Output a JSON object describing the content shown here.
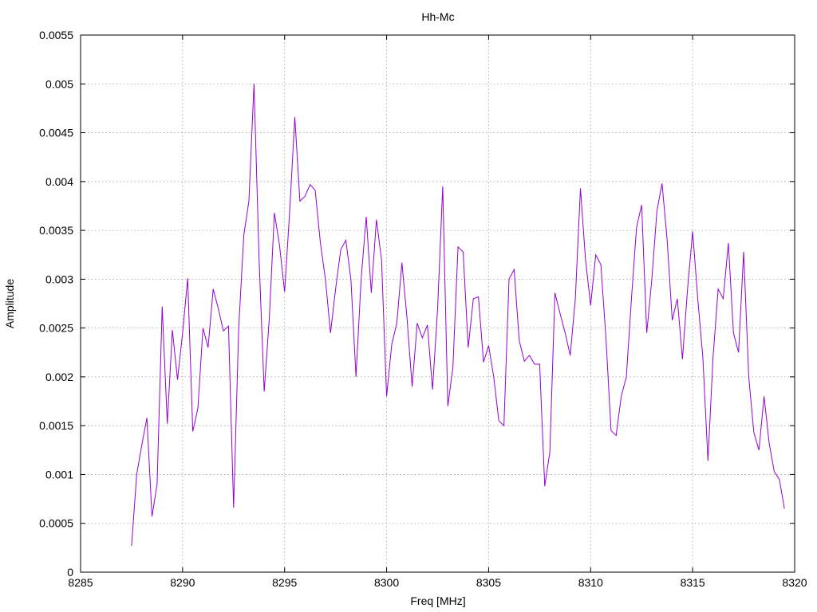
{
  "chart_data": {
    "type": "line",
    "title": "Hh-Mc",
    "xlabel": "Freq [MHz]",
    "ylabel": "Amplitude",
    "xlim": [
      8285,
      8320
    ],
    "ylim": [
      0,
      0.0055
    ],
    "x_ticks": [
      8285,
      8290,
      8295,
      8300,
      8305,
      8310,
      8315,
      8320
    ],
    "y_ticks": [
      0,
      0.0005,
      0.001,
      0.0015,
      0.002,
      0.0025,
      0.003,
      0.0035,
      0.004,
      0.0045,
      0.005,
      0.0055
    ],
    "grid": true,
    "series_color": "#9400d3",
    "series": [
      {
        "x": [
          8287.5,
          8287.75,
          8288.0,
          8288.25,
          8288.5,
          8288.75,
          8289.0,
          8289.25,
          8289.5,
          8289.75,
          8290.0,
          8290.25,
          8290.5,
          8290.75,
          8291.0,
          8291.25,
          8291.5,
          8291.75,
          8292.0,
          8292.25,
          8292.5,
          8292.75,
          8293.0,
          8293.25,
          8293.5,
          8293.75,
          8294.0,
          8294.25,
          8294.5,
          8294.75,
          8295.0,
          8295.25,
          8295.5,
          8295.75,
          8296.0,
          8296.25,
          8296.5,
          8296.75,
          8297.0,
          8297.25,
          8297.5,
          8297.75,
          8298.0,
          8298.25,
          8298.5,
          8298.75,
          8299.0,
          8299.25,
          8299.5,
          8299.75,
          8300.0,
          8300.25,
          8300.5,
          8300.75,
          8301.0,
          8301.25,
          8301.5,
          8301.75,
          8302.0,
          8302.25,
          8302.5,
          8302.75,
          8303.0,
          8303.25,
          8303.5,
          8303.75,
          8304.0,
          8304.25,
          8304.5,
          8304.75,
          8305.0,
          8305.25,
          8305.5,
          8305.75,
          8306.0,
          8306.25,
          8306.5,
          8306.75,
          8307.0,
          8307.25,
          8307.5,
          8307.75,
          8308.0,
          8308.25,
          8308.5,
          8308.75,
          8309.0,
          8309.25,
          8309.5,
          8309.75,
          8310.0,
          8310.25,
          8310.5,
          8310.75,
          8311.0,
          8311.25,
          8311.5,
          8311.75,
          8312.0,
          8312.25,
          8312.5,
          8312.75,
          8313.0,
          8313.25,
          8313.5,
          8313.75,
          8314.0,
          8314.25,
          8314.5,
          8314.75,
          8315.0,
          8315.25,
          8315.5,
          8315.75,
          8316.0,
          8316.25,
          8316.5,
          8316.75,
          8317.0,
          8317.25,
          8317.5,
          8317.75,
          8318.0,
          8318.25,
          8318.5,
          8318.75,
          8319.0,
          8319.25,
          8319.5
        ],
        "y": [
          0.00027,
          0.001,
          0.0013,
          0.00158,
          0.00057,
          0.0009,
          0.00272,
          0.00152,
          0.00248,
          0.00197,
          0.00245,
          0.00301,
          0.00144,
          0.00168,
          0.0025,
          0.0023,
          0.0029,
          0.0027,
          0.00247,
          0.00252,
          0.00066,
          0.0025,
          0.00345,
          0.0038,
          0.005,
          0.0032,
          0.00185,
          0.0026,
          0.00368,
          0.00335,
          0.00287,
          0.0037,
          0.00466,
          0.0038,
          0.00385,
          0.00397,
          0.00391,
          0.00338,
          0.003,
          0.00245,
          0.0029,
          0.0033,
          0.0034,
          0.003,
          0.002,
          0.003,
          0.00364,
          0.00286,
          0.00361,
          0.0032,
          0.0018,
          0.00233,
          0.00255,
          0.00317,
          0.0026,
          0.0019,
          0.00255,
          0.0024,
          0.00253,
          0.00187,
          0.0027,
          0.00395,
          0.0017,
          0.0021,
          0.00333,
          0.00328,
          0.0023,
          0.0028,
          0.00282,
          0.00215,
          0.00232,
          0.002,
          0.00155,
          0.0015,
          0.003,
          0.0031,
          0.00237,
          0.00216,
          0.00222,
          0.00213,
          0.00213,
          0.00088,
          0.00123,
          0.00286,
          0.00265,
          0.00245,
          0.00222,
          0.0028,
          0.00393,
          0.0032,
          0.00273,
          0.00325,
          0.00315,
          0.0024,
          0.00145,
          0.0014,
          0.0018,
          0.002,
          0.0028,
          0.00353,
          0.00376,
          0.00245,
          0.003,
          0.0037,
          0.00398,
          0.0034,
          0.00258,
          0.0028,
          0.00218,
          0.0029,
          0.00349,
          0.0028,
          0.0022,
          0.00114,
          0.0022,
          0.0029,
          0.0028,
          0.00337,
          0.00245,
          0.00225,
          0.00328,
          0.002,
          0.00143,
          0.00125,
          0.0018,
          0.00132,
          0.00103,
          0.00095,
          0.00065
        ]
      }
    ]
  }
}
